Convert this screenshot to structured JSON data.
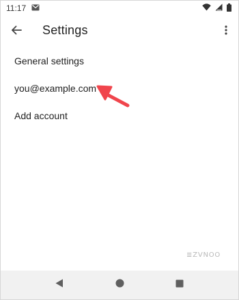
{
  "status_bar": {
    "time": "11:17",
    "icons": [
      "gmail-icon",
      "wifi-icon",
      "signal-icon",
      "battery-icon"
    ]
  },
  "app_bar": {
    "title": "Settings",
    "back_icon": "arrow-back-icon",
    "menu_icon": "more-vert-icon"
  },
  "settings": {
    "items": [
      {
        "label": "General settings"
      },
      {
        "label": "you@example.com"
      },
      {
        "label": "Add account"
      }
    ]
  },
  "annotation": {
    "color": "#f0454c"
  },
  "watermark": {
    "text": "ZVNOO"
  },
  "nav_bar": {
    "icons": [
      "nav-back-icon",
      "nav-home-icon",
      "nav-recents-icon"
    ],
    "icon_color": "#5f5f5f"
  }
}
